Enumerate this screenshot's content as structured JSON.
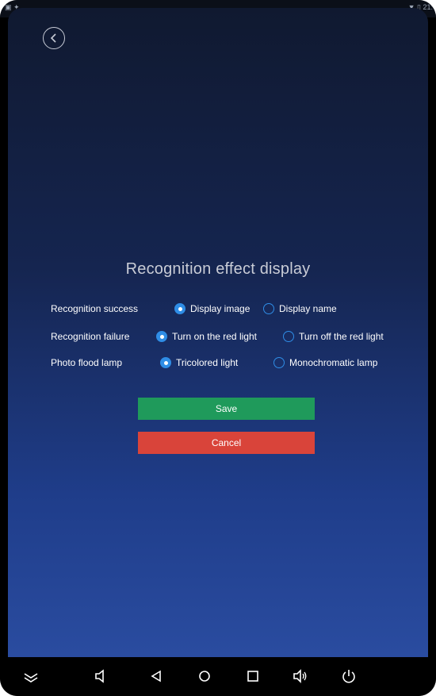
{
  "status_bar": {
    "time": "21:"
  },
  "title": "Recognition effect display",
  "settings": [
    {
      "label": "Recognition success",
      "options": [
        {
          "label": "Display image",
          "checked": true
        },
        {
          "label": "Display name",
          "checked": false
        }
      ]
    },
    {
      "label": "Recognition failure",
      "options": [
        {
          "label": "Turn on the red light",
          "checked": true
        },
        {
          "label": "Turn off the red light",
          "checked": false
        }
      ]
    },
    {
      "label": "Photo flood lamp",
      "options": [
        {
          "label": "Tricolored light",
          "checked": true
        },
        {
          "label": "Monochromatic lamp",
          "checked": false
        }
      ]
    }
  ],
  "buttons": {
    "save": "Save",
    "cancel": "Cancel"
  },
  "colors": {
    "save": "#1f9a5b",
    "cancel": "#d9443a",
    "radio": "#2f8de6"
  },
  "nav_icons": [
    "expand-icon",
    "volume-down-icon",
    "back-icon",
    "home-icon",
    "recents-icon",
    "volume-up-icon",
    "power-icon"
  ]
}
